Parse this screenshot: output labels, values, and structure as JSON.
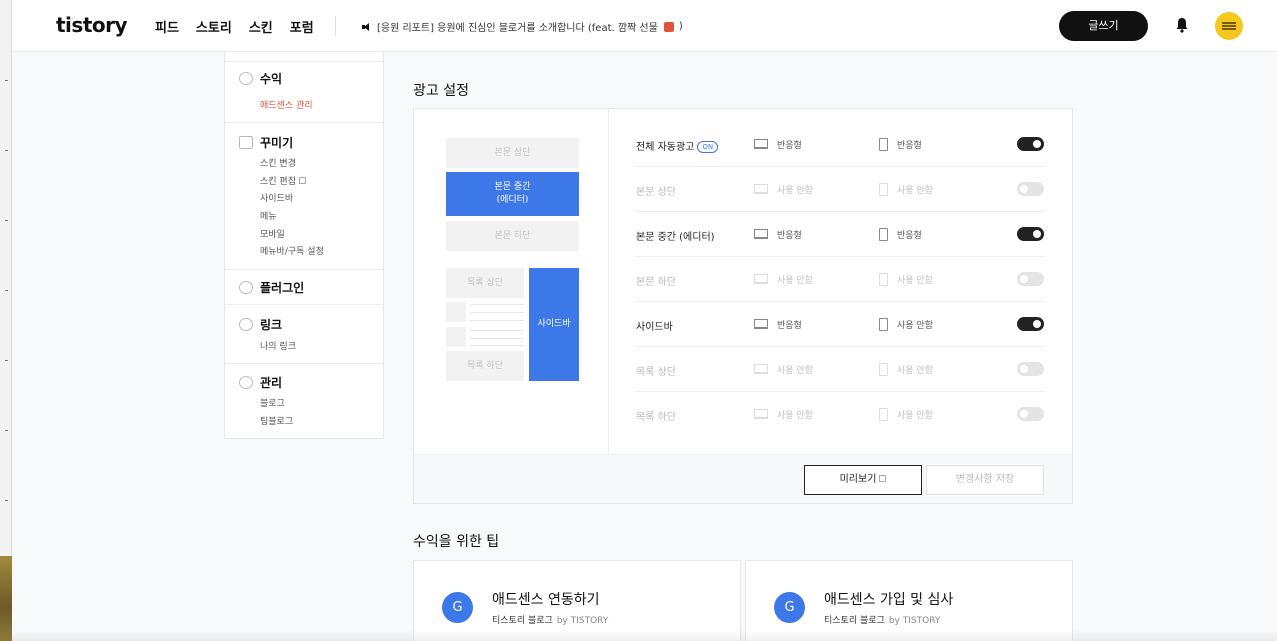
{
  "header": {
    "logo": "tistory",
    "nav": [
      "피드",
      "스토리",
      "스킨",
      "포럼"
    ],
    "notice": "[응원 리포트] 응원에 진심인 블로거를 소개합니다 (feat. 깜짝 선물",
    "write_label": "글쓰기"
  },
  "sidebar": {
    "revenue": {
      "title": "수익",
      "items": [
        "애드센스 관리"
      ]
    },
    "decorate": {
      "title": "꾸미기",
      "items": [
        "스킨 변경",
        "스킨 편집",
        "사이드바",
        "메뉴",
        "모바일",
        "메뉴바/구독 설정"
      ]
    },
    "plugin": {
      "title": "플러그인"
    },
    "link": {
      "title": "링크",
      "items": [
        "나의 링크"
      ]
    },
    "manage": {
      "title": "관리",
      "items": [
        "블로그",
        "팀블로그"
      ]
    }
  },
  "ad_settings": {
    "title": "광고 설정",
    "preview": {
      "body_top": "본문 상단",
      "body_mid_1": "본문 중간",
      "body_mid_2": "(에디터)",
      "body_bottom": "본문 하단",
      "list_top": "목록 상단",
      "list_bottom": "목록 하단",
      "sidebar": "사이드바"
    },
    "on_badge": "ON",
    "rows": [
      {
        "label": "전체 자동광고",
        "pc": "반응형",
        "mobile": "반응형",
        "enabled": true
      },
      {
        "label": "본문 상단",
        "pc": "사용 안함",
        "mobile": "사용 안함",
        "enabled": false
      },
      {
        "label": "본문 중간 (에디터)",
        "pc": "반응형",
        "mobile": "반응형",
        "enabled": true
      },
      {
        "label": "본문 하단",
        "pc": "사용 안함",
        "mobile": "사용 안함",
        "enabled": false
      },
      {
        "label": "사이드바",
        "pc": "반응형",
        "mobile": "사용 안함",
        "enabled": true
      },
      {
        "label": "목록 상단",
        "pc": "사용 안함",
        "mobile": "사용 안함",
        "enabled": false
      },
      {
        "label": "목록 하단",
        "pc": "사용 안함",
        "mobile": "사용 안함",
        "enabled": false
      }
    ],
    "preview_button": "미리보기",
    "save_button": "변경사항 저장"
  },
  "tips": {
    "title": "수익을 위한 팁",
    "cards": [
      {
        "icon": "G",
        "title": "애드센스 연동하기",
        "source": "티스토리 블로그",
        "by": "by TISTORY"
      },
      {
        "icon": "G",
        "title": "애드센스 가입 및 심사",
        "source": "티스토리 블로그",
        "by": "by TISTORY"
      }
    ]
  },
  "colors": {
    "accent": "#3d78e8",
    "active_menu": "#e8503a",
    "toggle_on": "#222222",
    "avatar": "#f6c81e"
  }
}
